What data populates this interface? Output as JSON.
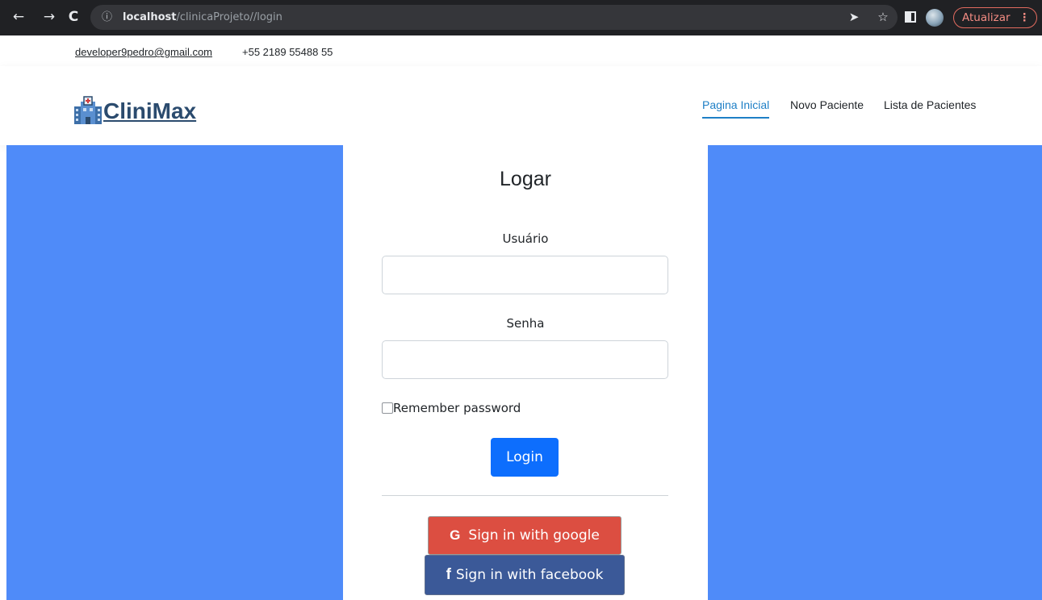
{
  "browser": {
    "url_host": "localhost",
    "url_path": "/clinicaProjeto//login",
    "update_label": "Atualizar",
    "icons": [
      "back-icon",
      "forward-icon",
      "reload-icon",
      "info-icon",
      "send-icon",
      "star-icon",
      "sidepanel-icon",
      "profile-avatar",
      "menu-icon"
    ]
  },
  "topbar": {
    "email": "developer9pedro@gmail.com",
    "phone": "+55 2189 55488 55"
  },
  "header": {
    "logo_text": "CliniMax",
    "nav": [
      {
        "label": "Pagina Inicial",
        "active": true
      },
      {
        "label": "Novo Paciente",
        "active": false
      },
      {
        "label": "Lista de Pacientes",
        "active": false
      }
    ]
  },
  "login": {
    "title": "Logar",
    "username_label": "Usuário",
    "username_value": "",
    "password_label": "Senha",
    "password_value": "",
    "remember_label": "Remember password",
    "remember_checked": false,
    "login_button": "Login",
    "google_button": "Sign in with google",
    "facebook_button": "Sign in with facebook"
  },
  "colors": {
    "page_background": "#4f8bf9",
    "primary": "#0d6efd",
    "nav_active": "#1e7fc6",
    "google": "#dc4e41",
    "facebook": "#3b5998",
    "logo_text": "#2b4b6e"
  }
}
